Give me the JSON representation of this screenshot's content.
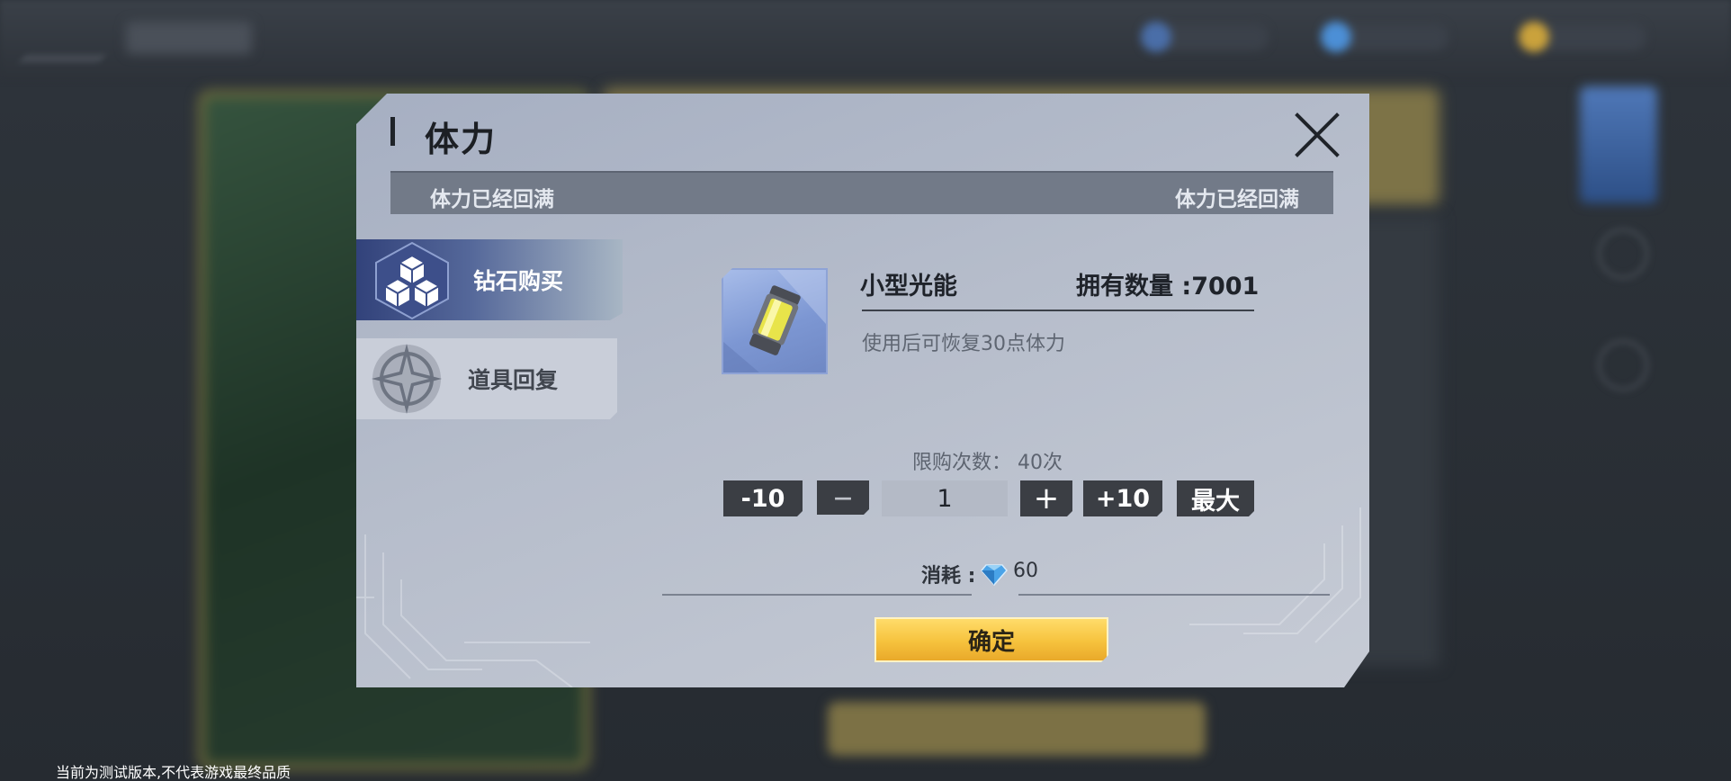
{
  "dialog": {
    "title": "体力",
    "status_left": "体力已经回满",
    "status_right": "体力已经回满"
  },
  "tabs": [
    {
      "label": "钻石购买",
      "icon": "cubes-icon",
      "active": true
    },
    {
      "label": "道具回复",
      "icon": "compass-star-icon",
      "active": false
    }
  ],
  "item": {
    "icon": "energy-canister-icon",
    "name": "小型光能",
    "owned": "拥有数量 :7001",
    "description": "使用后可恢复30点体力"
  },
  "purchase": {
    "limit_text": "限购次数： 40次",
    "minus10_label": "-10",
    "minus_label": "—",
    "quantity": "1",
    "plus_label": "+",
    "plus10_label": "+10",
    "max_label": "最大",
    "cost_label": "消耗 :",
    "cost_icon": "diamond-icon",
    "cost_value": "60",
    "confirm_label": "确定"
  },
  "footer": {
    "note": "当前为测试版本,不代表游戏最终品质"
  },
  "colors": {
    "confirm_button": "#f6c23d",
    "active_tab": "#2f3f78",
    "dark_button": "#3b3e44"
  }
}
